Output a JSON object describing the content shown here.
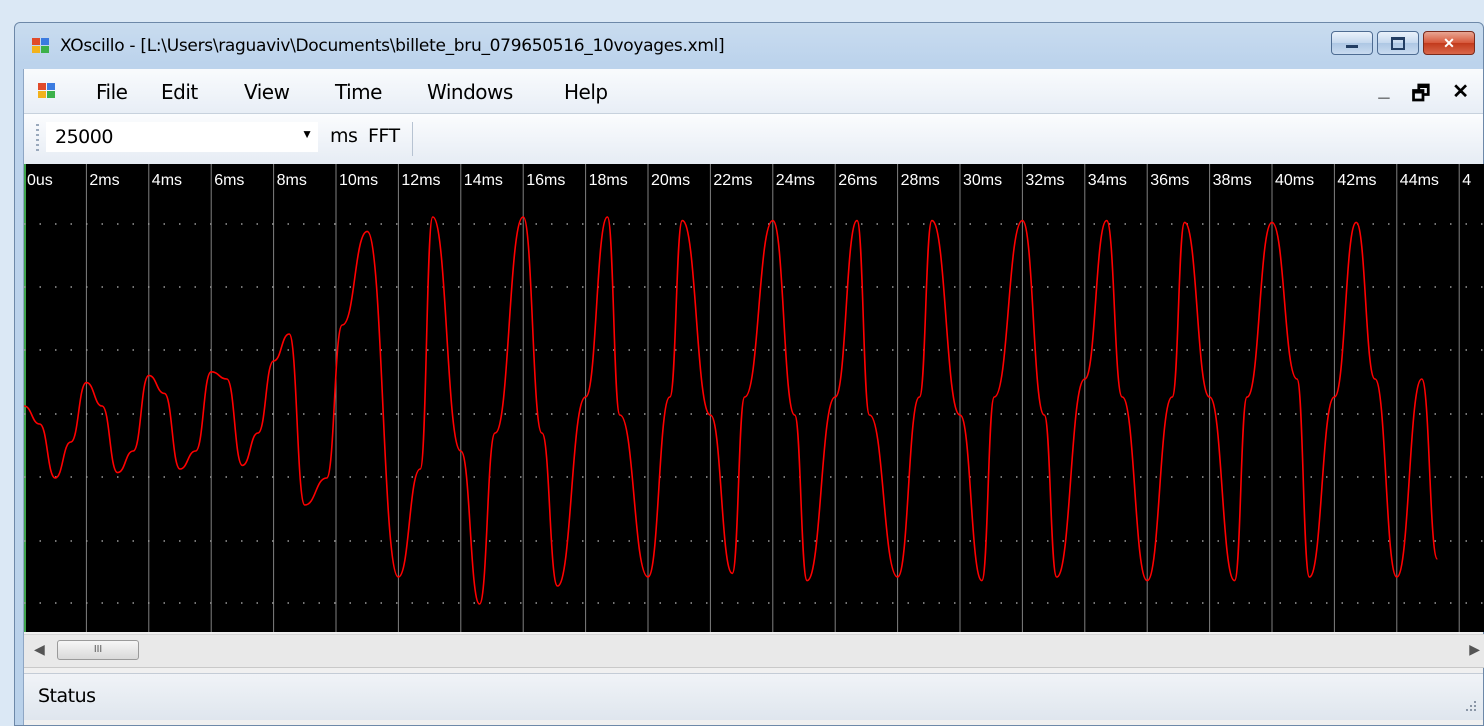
{
  "window": {
    "title": "XOscillo - [L:\\Users\\raguaviv\\Documents\\billete_bru_079650516_10voyages.xml]",
    "icon": "app-icon"
  },
  "menu": {
    "items": [
      "File",
      "Edit",
      "View",
      "Time",
      "Windows",
      "Help"
    ],
    "mdi_controls": [
      "_",
      "🗗",
      "✕"
    ]
  },
  "toolbar": {
    "time_value": "25000",
    "unit_label": "ms",
    "fft_label": "FFT"
  },
  "scope": {
    "time_labels": [
      "0us",
      "2ms",
      "4ms",
      "6ms",
      "8ms",
      "10ms",
      "12ms",
      "14ms",
      "16ms",
      "18ms",
      "20ms",
      "22ms",
      "24ms",
      "26ms",
      "28ms",
      "30ms",
      "32ms",
      "34ms",
      "36ms",
      "38ms",
      "40ms",
      "42ms",
      "44ms",
      "4"
    ],
    "trace_color": "#ff0000",
    "background_color": "#000000",
    "grid_color": "#808080"
  },
  "chart_data": {
    "type": "line",
    "title": "",
    "xlabel": "",
    "ylabel": "",
    "grid": true,
    "series": [
      {
        "x_ms": [
          0,
          0.5,
          1,
          1.5,
          2,
          2.5,
          3,
          3.5,
          4,
          4.5,
          5,
          5.5,
          6,
          6.5,
          7,
          7.5,
          8,
          8.5,
          9,
          9.7,
          10.2,
          11,
          12,
          12.7,
          13.1,
          14,
          14.6,
          15.1,
          16,
          16.6,
          17.1,
          18,
          18.7,
          19.1,
          20,
          20.7,
          21.1,
          22,
          22.7,
          23.1,
          24,
          24.7,
          25.1,
          26,
          26.7,
          27.1,
          28,
          28.7,
          29.1,
          30,
          30.7,
          31.1,
          32,
          32.7,
          33.1,
          34,
          34.7,
          35.2,
          36,
          36.8,
          37.2,
          38,
          38.8,
          39.2,
          40,
          40.8,
          41.2,
          42,
          42.7,
          43.3,
          44,
          44.8,
          45.3
        ],
        "y": [
          -0.05,
          -0.15,
          -0.45,
          -0.25,
          0.08,
          -0.05,
          -0.42,
          -0.3,
          0.12,
          0.02,
          -0.4,
          -0.3,
          0.14,
          0.1,
          -0.38,
          -0.2,
          0.2,
          0.35,
          -0.6,
          -0.45,
          0.4,
          0.92,
          -1.0,
          -0.4,
          1.0,
          -0.3,
          -1.15,
          -0.2,
          1.0,
          -0.2,
          -1.05,
          0.0,
          1.0,
          -0.1,
          -1.0,
          0.0,
          0.98,
          -0.1,
          -0.98,
          0.0,
          0.98,
          -0.1,
          -1.02,
          0.0,
          0.98,
          -0.1,
          -1.0,
          0.0,
          0.98,
          -0.1,
          -1.02,
          0.0,
          0.98,
          -0.1,
          -1.0,
          0.1,
          0.98,
          0.0,
          -1.02,
          0.0,
          0.97,
          0.0,
          -1.02,
          0.0,
          0.97,
          0.1,
          -1.0,
          0.0,
          0.97,
          0.1,
          -1.0,
          0.1,
          -0.9
        ]
      }
    ]
  },
  "scrollbar": {
    "thumb_label": "III"
  },
  "status": {
    "text": "Status"
  }
}
